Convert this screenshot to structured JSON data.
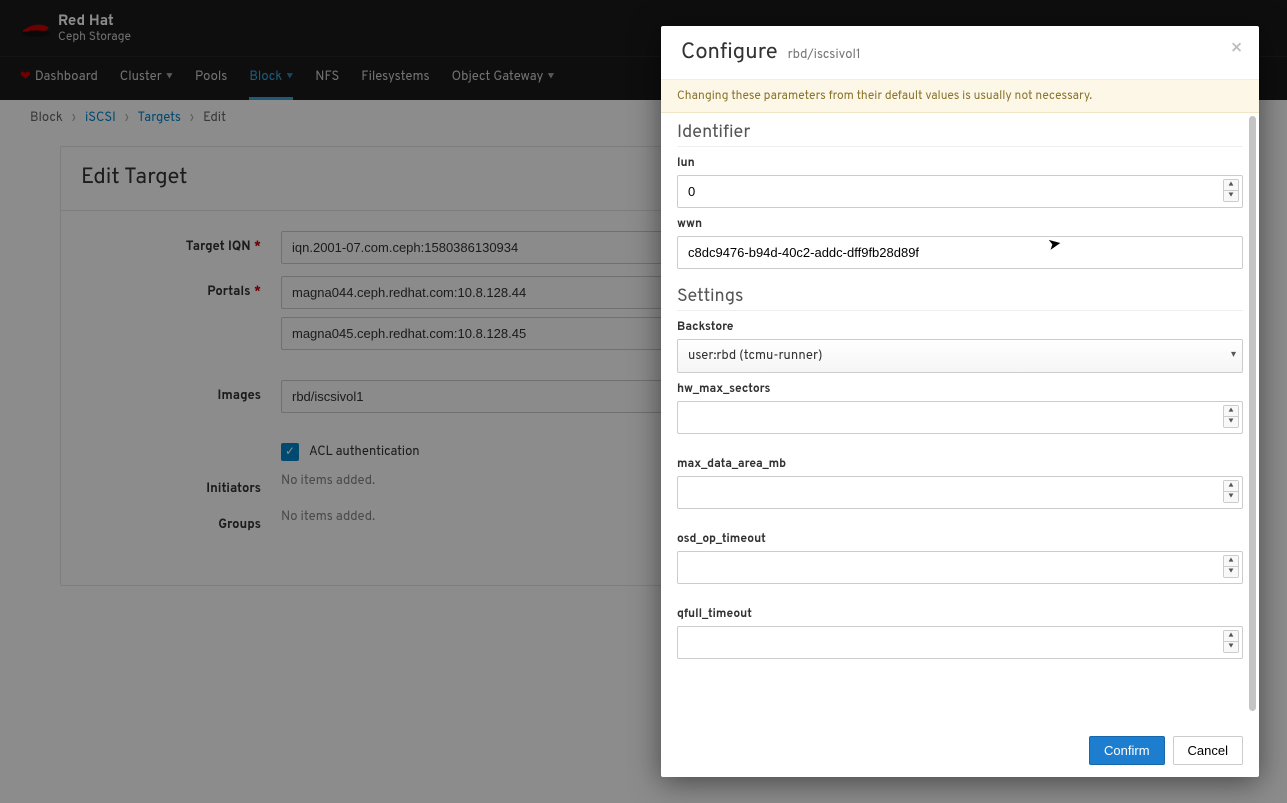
{
  "brand": {
    "name": "Red Hat",
    "product": "Ceph Storage"
  },
  "nav": {
    "dashboard": "Dashboard",
    "cluster": "Cluster",
    "pools": "Pools",
    "block": "Block",
    "nfs": "NFS",
    "filesystems": "Filesystems",
    "object_gateway": "Object Gateway"
  },
  "breadcrumb": {
    "block": "Block",
    "iscsi": "iSCSI",
    "targets": "Targets",
    "edit": "Edit"
  },
  "panel": {
    "title": "Edit Target",
    "labels": {
      "target_iqn": "Target IQN",
      "portals": "Portals",
      "images": "Images",
      "initiators": "Initiators",
      "groups": "Groups"
    },
    "target_iqn": "iqn.2001-07.com.ceph:1580386130934",
    "portals": [
      "magna044.ceph.redhat.com:10.8.128.44",
      "magna045.ceph.redhat.com:10.8.128.45"
    ],
    "images": [
      "rbd/iscsivol1"
    ],
    "acl_label": "ACL authentication",
    "acl_checked": true,
    "no_items": "No items added."
  },
  "modal": {
    "title": "Configure",
    "subtitle": "rbd/iscsivol1",
    "warning": "Changing these parameters from their default values is usually not necessary.",
    "sections": {
      "identifier": "Identifier",
      "settings": "Settings"
    },
    "fields": {
      "lun": {
        "label": "lun",
        "value": "0"
      },
      "wwn": {
        "label": "wwn",
        "value": "c8dc9476-b94d-40c2-addc-dff9fb28d89f"
      },
      "backstore": {
        "label": "Backstore",
        "value": "user:rbd (tcmu-runner)"
      },
      "hw_max_sectors": {
        "label": "hw_max_sectors",
        "value": ""
      },
      "max_data_area_mb": {
        "label": "max_data_area_mb",
        "value": ""
      },
      "osd_op_timeout": {
        "label": "osd_op_timeout",
        "value": ""
      },
      "qfull_timeout": {
        "label": "qfull_timeout",
        "value": ""
      }
    },
    "buttons": {
      "confirm": "Confirm",
      "cancel": "Cancel"
    }
  }
}
